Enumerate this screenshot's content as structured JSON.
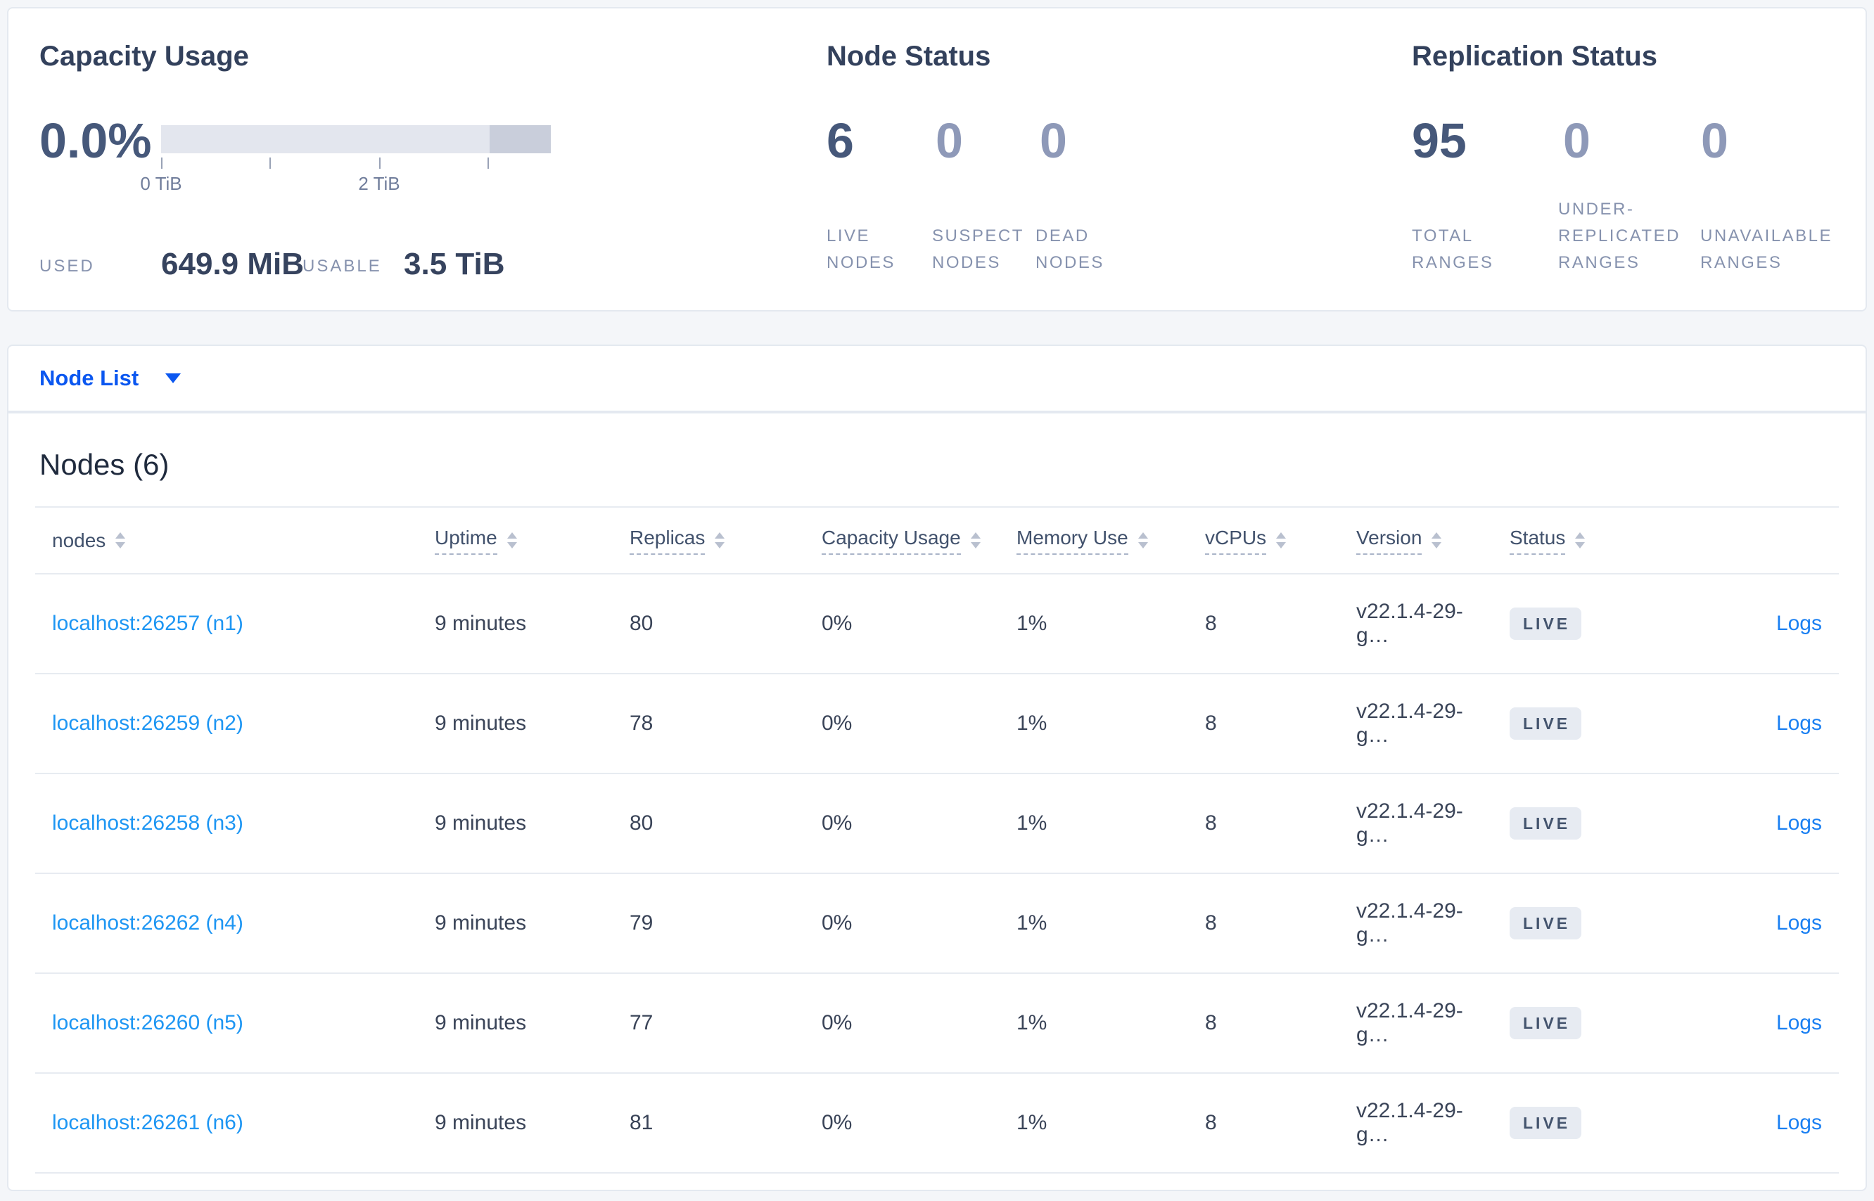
{
  "colors": {
    "page_bg": "#f4f6f9",
    "card_border": "#e4e9f0",
    "title_text": "#33415c",
    "big_number": "#46587a",
    "muted_number": "#8e99b8",
    "stat_label": "#8692ae",
    "link_blue": "#1e96f3",
    "logs_blue": "#1b80f2",
    "selector_blue": "#0b57f0",
    "badge_bg": "#e7ebf2",
    "badge_text": "#44546e",
    "bar_light": "#e3e6ee",
    "bar_dark": "#c9cedb"
  },
  "summary": {
    "capacity": {
      "title": "Capacity Usage",
      "percent": "0.0%",
      "tick_label_0": "0 TiB",
      "tick_label_2": "2 TiB",
      "used_label": "USED",
      "used_value": "649.9 MiB",
      "usable_label": "USABLE",
      "usable_value": "3.5 TiB"
    },
    "node_status": {
      "title": "Node Status",
      "stats": [
        {
          "value": "6",
          "label": "LIVE NODES"
        },
        {
          "value": "0",
          "label": "SUSPECT NODES"
        },
        {
          "value": "0",
          "label": "DEAD NODES"
        }
      ]
    },
    "replication": {
      "title": "Replication Status",
      "stats": [
        {
          "value": "95",
          "label": "TOTAL RANGES"
        },
        {
          "value": "0",
          "label": "UNDER-REPLICATED RANGES"
        },
        {
          "value": "0",
          "label": "UNAVAILABLE RANGES"
        }
      ]
    }
  },
  "view_selector": {
    "label": "Node List"
  },
  "table": {
    "title": "Nodes (6)",
    "columns": [
      "nodes",
      "Uptime",
      "Replicas",
      "Capacity Usage",
      "Memory Use",
      "vCPUs",
      "Version",
      "Status"
    ],
    "rows": [
      {
        "node": "localhost:26257 (n1)",
        "uptime": "9 minutes",
        "replicas": "80",
        "capacity": "0%",
        "memory": "1%",
        "vcpus": "8",
        "version": "v22.1.4-29-g…",
        "status": "LIVE",
        "logs": "Logs"
      },
      {
        "node": "localhost:26259 (n2)",
        "uptime": "9 minutes",
        "replicas": "78",
        "capacity": "0%",
        "memory": "1%",
        "vcpus": "8",
        "version": "v22.1.4-29-g…",
        "status": "LIVE",
        "logs": "Logs"
      },
      {
        "node": "localhost:26258 (n3)",
        "uptime": "9 minutes",
        "replicas": "80",
        "capacity": "0%",
        "memory": "1%",
        "vcpus": "8",
        "version": "v22.1.4-29-g…",
        "status": "LIVE",
        "logs": "Logs"
      },
      {
        "node": "localhost:26262 (n4)",
        "uptime": "9 minutes",
        "replicas": "79",
        "capacity": "0%",
        "memory": "1%",
        "vcpus": "8",
        "version": "v22.1.4-29-g…",
        "status": "LIVE",
        "logs": "Logs"
      },
      {
        "node": "localhost:26260 (n5)",
        "uptime": "9 minutes",
        "replicas": "77",
        "capacity": "0%",
        "memory": "1%",
        "vcpus": "8",
        "version": "v22.1.4-29-g…",
        "status": "LIVE",
        "logs": "Logs"
      },
      {
        "node": "localhost:26261 (n6)",
        "uptime": "9 minutes",
        "replicas": "81",
        "capacity": "0%",
        "memory": "1%",
        "vcpus": "8",
        "version": "v22.1.4-29-g…",
        "status": "LIVE",
        "logs": "Logs"
      }
    ]
  }
}
